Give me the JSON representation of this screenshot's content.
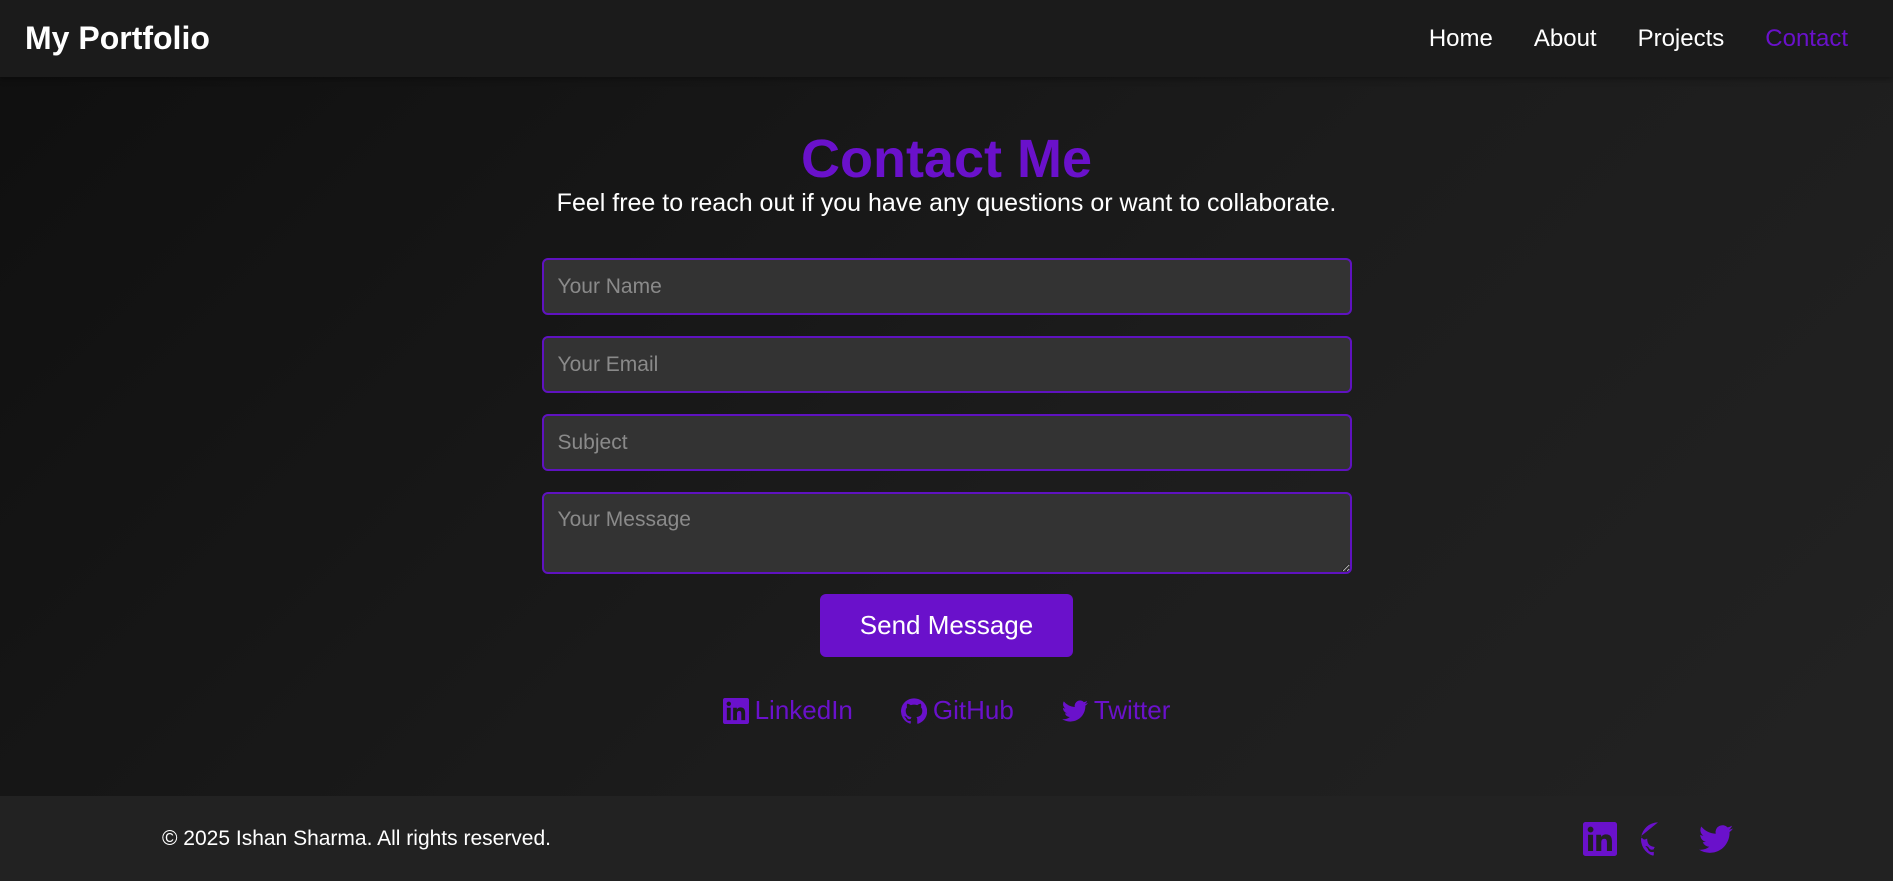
{
  "nav": {
    "logo": "My Portfolio",
    "links": [
      {
        "label": "Home"
      },
      {
        "label": "About"
      },
      {
        "label": "Projects"
      },
      {
        "label": "Contact",
        "active": true
      }
    ]
  },
  "contact": {
    "title": "Contact Me",
    "subtitle": "Feel free to reach out if you have any questions or want to collaborate.",
    "form": {
      "name_placeholder": "Your Name",
      "email_placeholder": "Your Email",
      "subject_placeholder": "Subject",
      "message_placeholder": "Your Message",
      "submit_label": "Send Message"
    },
    "social": [
      {
        "label": "LinkedIn",
        "icon": "linkedin-icon"
      },
      {
        "label": "GitHub",
        "icon": "github-icon"
      },
      {
        "label": "Twitter",
        "icon": "twitter-icon"
      }
    ]
  },
  "footer": {
    "copyright": "© 2025 Ishan Sharma. All rights reserved.",
    "icons": [
      "linkedin-icon",
      "github-icon",
      "twitter-icon"
    ]
  },
  "colors": {
    "accent": "#6a11cb",
    "background": "#1b1b1b",
    "input_bg": "#333333"
  }
}
